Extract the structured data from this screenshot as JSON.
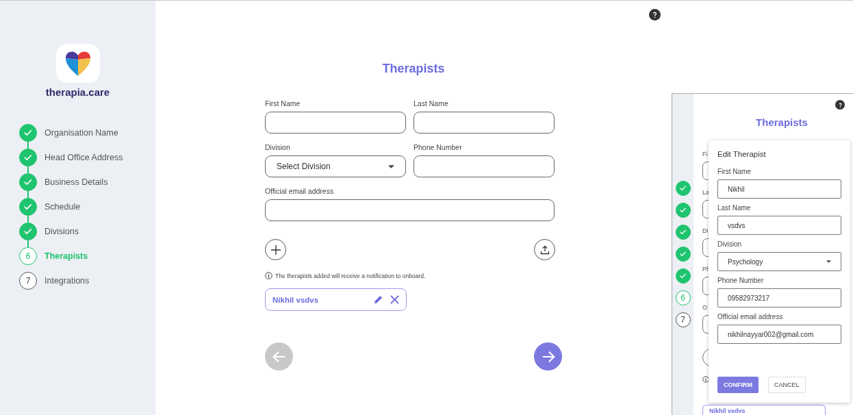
{
  "brand": {
    "name": "therapia.care"
  },
  "steps": [
    {
      "label": "Organisation Name",
      "done": true
    },
    {
      "label": "Head Office Address",
      "done": true
    },
    {
      "label": "Business Details",
      "done": true
    },
    {
      "label": "Schedule",
      "done": true
    },
    {
      "label": "Divisions",
      "done": true
    },
    {
      "number": "6",
      "label": "Therapists",
      "done": false,
      "current": true
    },
    {
      "number": "7",
      "label": "Integrations",
      "done": false,
      "current": false
    }
  ],
  "form": {
    "title": "Therapists",
    "fields": [
      {
        "kind": "text",
        "label": "First Name"
      },
      {
        "kind": "text",
        "label": "Last Name"
      },
      {
        "kind": "select",
        "label": "Division",
        "placeholder": "Select Division"
      },
      {
        "kind": "text",
        "label": "Phone Number"
      }
    ],
    "email_field": {
      "label": "Official email address"
    }
  },
  "notice": "The therapists added will receive a notification to onboard.",
  "therapists": [
    {
      "name": "Nikhil vsdvs"
    }
  ],
  "nav": {
    "back": {
      "disabled": true
    },
    "next": {
      "disabled": false
    }
  },
  "preview": {
    "title": "Therapists",
    "steps": [
      {
        "done": true
      },
      {
        "done": true
      },
      {
        "done": true
      },
      {
        "done": true
      },
      {
        "done": true
      },
      {
        "number": "6",
        "done": false,
        "current": true
      },
      {
        "number": "7",
        "done": false,
        "current": false
      }
    ],
    "field_labels": [
      "Fi",
      "La",
      "Di",
      "Ph",
      "O"
    ],
    "chip": "Nikhil vsdvs"
  },
  "dialog": {
    "title": "Edit Therapist",
    "fields": [
      {
        "kind": "text",
        "label": "First Name",
        "value": "Nikhil"
      },
      {
        "kind": "text",
        "label": "Last Name",
        "value": "vsdvs"
      },
      {
        "kind": "select",
        "label": "Division",
        "value": "Psychology"
      },
      {
        "kind": "text",
        "label": "Phone Number",
        "value": "09582973217"
      },
      {
        "kind": "text",
        "label": "Official email address",
        "value": "nikhilnayyar002@gmail.com"
      }
    ],
    "buttons": [
      {
        "label": "CONFIRM",
        "kind": "primary"
      },
      {
        "label": "CANCEL",
        "kind": "secondary"
      }
    ]
  }
}
